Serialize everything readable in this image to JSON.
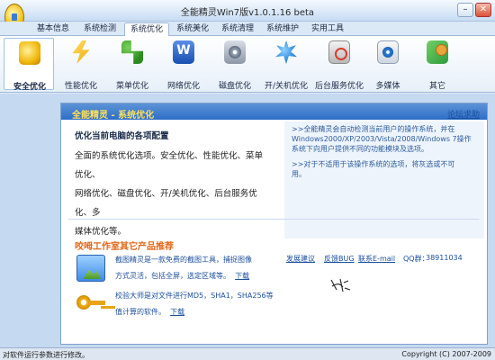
{
  "window": {
    "title": "全能精灵Win7版v1.0.1.16 beta",
    "buttons": {
      "minimize": "–",
      "close": "✕"
    }
  },
  "tabs": [
    {
      "label": "基本信息",
      "active": false
    },
    {
      "label": "系统检测",
      "active": false
    },
    {
      "label": "系统优化",
      "active": true
    },
    {
      "label": "系统美化",
      "active": false
    },
    {
      "label": "系统清理",
      "active": false
    },
    {
      "label": "系统维护",
      "active": false
    },
    {
      "label": "实用工具",
      "active": false
    }
  ],
  "toolbar": [
    {
      "label": "安全优化",
      "icon": "shield-icon",
      "active": true
    },
    {
      "label": "性能优化",
      "icon": "lightning-icon",
      "active": false
    },
    {
      "label": "菜单优化",
      "icon": "menu-icon",
      "active": false
    },
    {
      "label": "网络优化",
      "icon": "network-icon",
      "active": false
    },
    {
      "label": "磁盘优化",
      "icon": "disk-icon",
      "active": false
    },
    {
      "label": "开/关机优化",
      "icon": "power-icon",
      "active": false
    },
    {
      "label": "后台服务优化",
      "icon": "service-icon",
      "active": false
    },
    {
      "label": "多媒体",
      "icon": "media-icon",
      "active": false
    },
    {
      "label": "其它",
      "icon": "other-icon",
      "active": false
    }
  ],
  "panel": {
    "title": "全能精灵 - 系统优化",
    "forum_link": "论坛求助",
    "section_title": "优化当前电脑的各项配置",
    "section_lines": [
      "全面的系统优化选项。安全优化、性能优化、菜单优化、",
      "网络优化、磁盘优化、开/关机优化、后台服务优化、多",
      "媒体优化等。"
    ],
    "info_lines": [
      ">>全能精灵会自动检测当前用户的操作系统，并在",
      "Windows2000/XP/2003/Vista/2008/Windows 7操作",
      "系统下向用户提供不同的功能模块及选项。",
      "",
      ">>对于不适用于该操作系统的选项，将灰选或不可",
      "用。"
    ],
    "promo_title": "咬呣工作室其它产品推荐",
    "products": [
      {
        "icon": "screenshot-tool-icon",
        "lines": [
          "截图精灵是一款免费的截图工具，捕捉图像",
          "方式灵活，包括全屏，选定区域等。"
        ],
        "download": "下载"
      },
      {
        "icon": "key-icon",
        "lines": [
          "校验大师是对文件进行MD5，SHA1，SHA256等",
          "值计算的软件。"
        ],
        "download": "下载"
      }
    ],
    "links": {
      "feedback": "发展建议",
      "bug": "反馈BUG",
      "email": "联系E-mail",
      "qq_label": "QQ群：",
      "qq_number": "38911034"
    }
  },
  "statusbar": {
    "left": "对软件运行参数进行修改。",
    "right": "Copyright (C) 2007-2009"
  }
}
